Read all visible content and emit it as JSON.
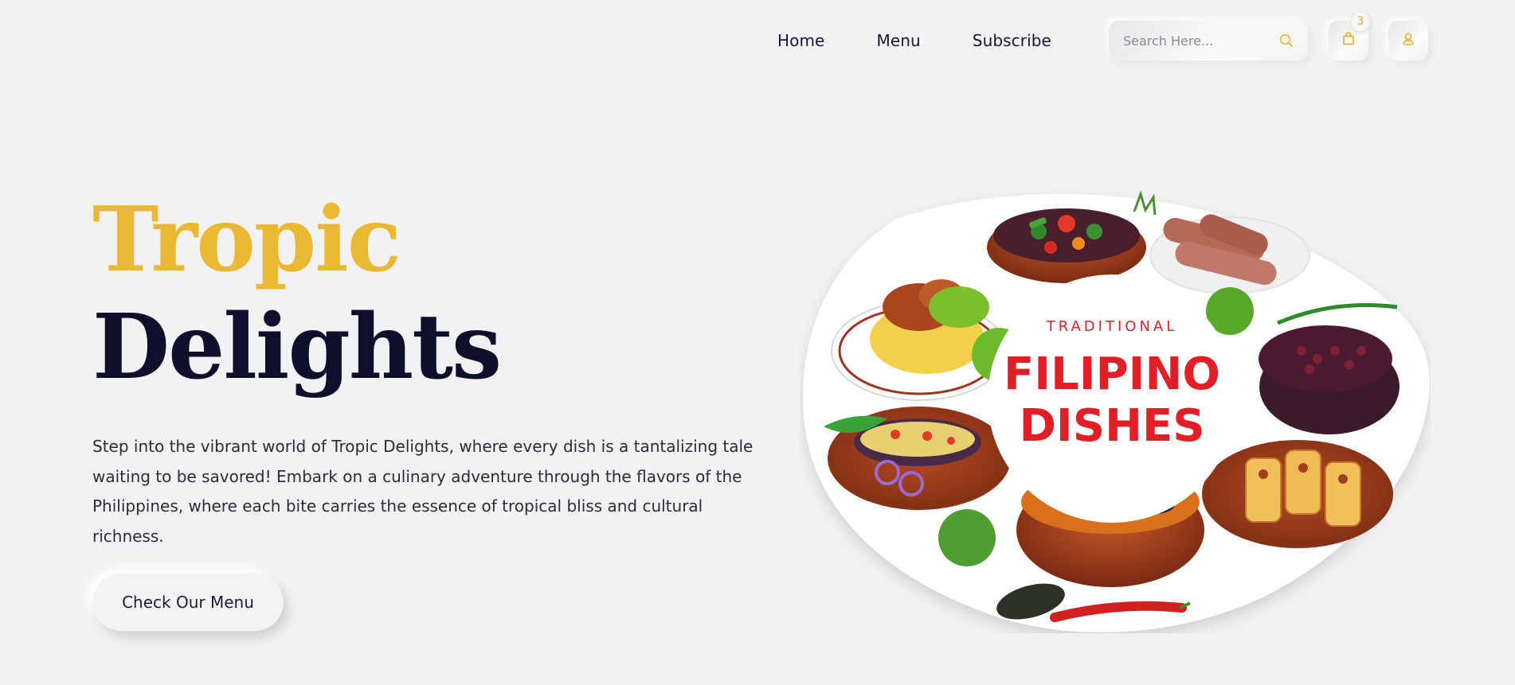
{
  "nav": {
    "links": [
      "Home",
      "Menu",
      "Subscribe"
    ],
    "search_placeholder": "Search Here...",
    "cart_count": "3",
    "icons": [
      "search-icon",
      "shopping-bag-icon",
      "user-icon"
    ]
  },
  "hero": {
    "title_line1": "Tropic",
    "title_line2": "Delights",
    "description": "Step into the vibrant world of Tropic Delights, where every dish is a tantalizing tale waiting to be savored! Embark on a culinary adventure through the flavors of the Philippines, where each bite carries the essence of tropical bliss and cultural richness.",
    "cta_label": "Check Our Menu"
  },
  "illustration": {
    "kicker": "TRADITIONAL",
    "heading_line1": "FILIPINO",
    "heading_line2": "DISHES"
  },
  "colors": {
    "accent_gold": "#ebb834",
    "dark_navy": "#0e0f2a",
    "background": "#f2f2f4",
    "dish_red": "#e21f26"
  }
}
